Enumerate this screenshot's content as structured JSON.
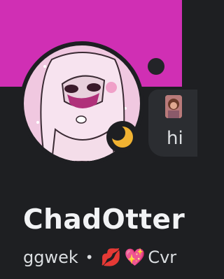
{
  "profile": {
    "display_name": "ChadOtter",
    "username": "ggwek",
    "separator": "•",
    "pronoun_emojis": [
      "💋",
      "💖"
    ],
    "bio_snippet": "Cvr"
  },
  "note": {
    "text": "hi"
  },
  "status": {
    "icon": "moon-idle-icon",
    "color": "#f0b232"
  },
  "colors": {
    "banner": "#d02fb4",
    "background": "#1e1f22",
    "bubble": "#2b2d31"
  }
}
